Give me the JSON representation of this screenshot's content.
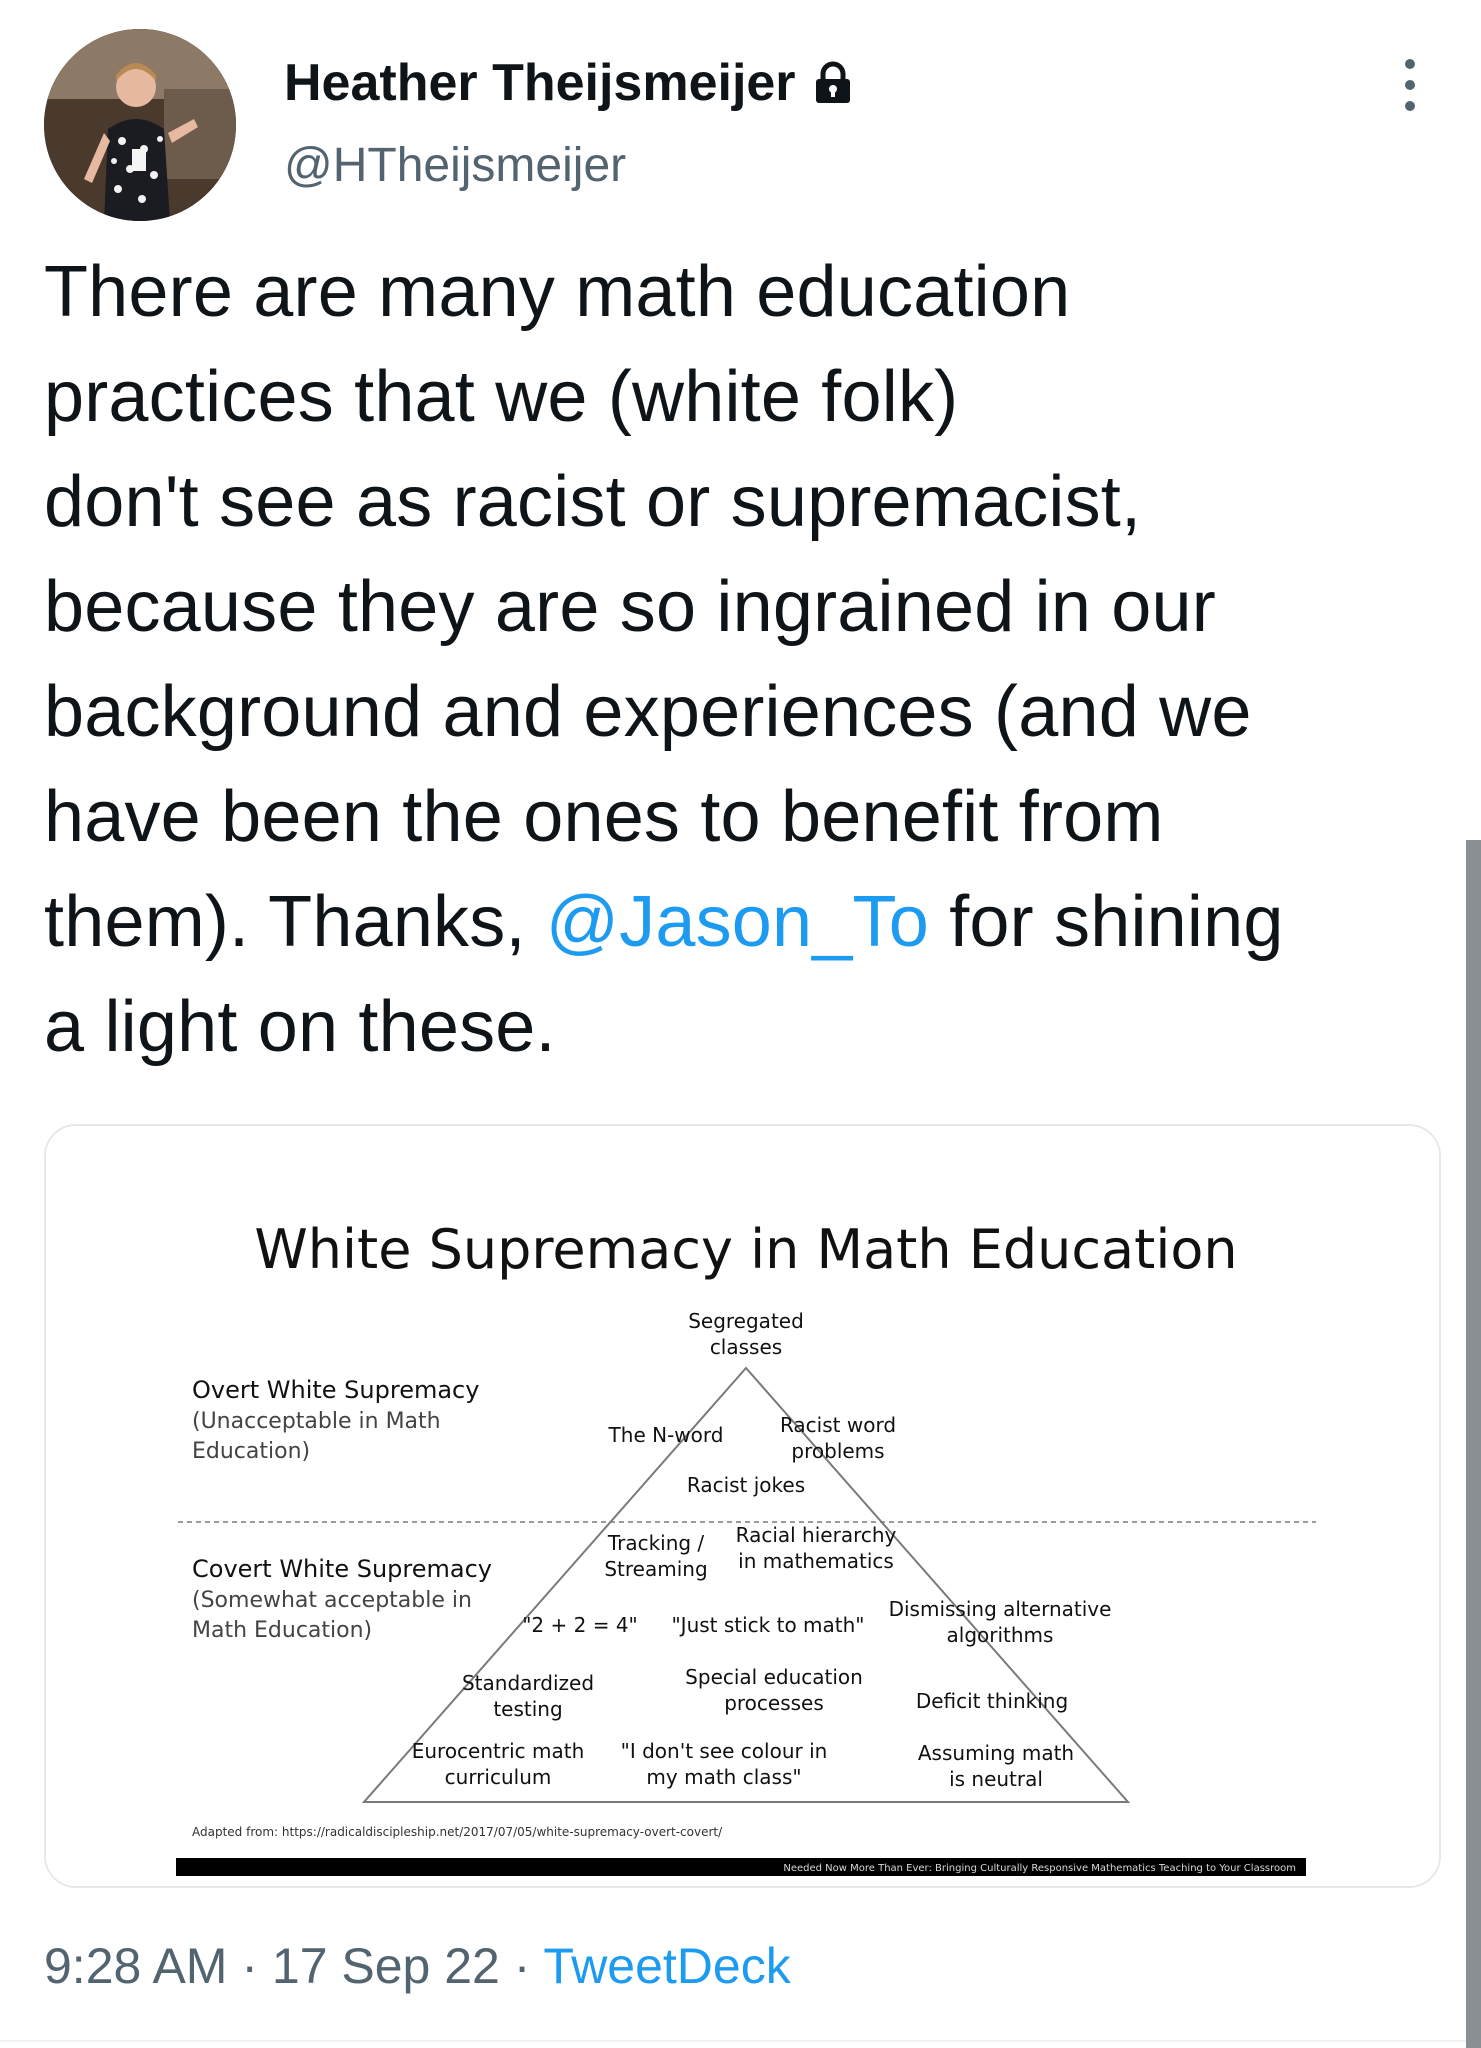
{
  "author": {
    "display_name": "Heather Theijsmeijer",
    "handle": "@HTheijsmeijer",
    "protected_icon": "lock-icon",
    "avatar": "avatar-photo"
  },
  "menu_icon": "more-vertical-icon",
  "tweet": {
    "lines": [
      "There are many math education",
      "practices that we (white folk)",
      "don't see as racist or supremacist,",
      "because they are so ingrained in our",
      "background and experiences (and we",
      "have been the ones to benefit from"
    ],
    "line7_prefix": "them). Thanks, ",
    "mention": "@Jason_To",
    "line7_suffix": " for shining",
    "line8": "a light on these."
  },
  "image": {
    "title": "White Supremacy in Math Education",
    "overt_heading": "Overt White Supremacy",
    "overt_sub_1": "(Unacceptable in Math",
    "overt_sub_2": "Education)",
    "covert_heading": "Covert White Supremacy",
    "covert_sub_1": "(Somewhat acceptable in",
    "covert_sub_2": "Math Education)",
    "apex_1": "Segregated",
    "apex_2": "classes",
    "nword": "The N-word",
    "racist_word_1": "Racist word",
    "racist_word_2": "problems",
    "racist_jokes": "Racist jokes",
    "tracking_1": "Tracking /",
    "tracking_2": "Streaming",
    "hierarchy_1": "Racial hierarchy",
    "hierarchy_2": "in mathematics",
    "dismissing_1": "Dismissing alternative",
    "dismissing_2": "algorithms",
    "two_plus_two": "\"2 + 2 = 4\"",
    "stick_to_math": "\"Just stick to math\"",
    "standardized_1": "Standardized",
    "standardized_2": "testing",
    "special_ed_1": "Special education",
    "special_ed_2": "processes",
    "deficit": "Deficit thinking",
    "eurocentric_1": "Eurocentric math",
    "eurocentric_2": "curriculum",
    "colour_1": "\"I don't see colour in",
    "colour_2": "my math class\"",
    "neutral_1": "Assuming math",
    "neutral_2": "is neutral",
    "source": "Adapted from: https://radicaldiscipleship.net/2017/07/05/white-supremacy-overt-covert/",
    "footer_banner": "Needed Now More Than Ever: Bringing Culturally Responsive Mathematics Teaching to Your Classroom"
  },
  "meta": {
    "time": "9:28 AM",
    "separator": " · ",
    "date": "17 Sep 22",
    "source_app": "TweetDeck"
  },
  "colors": {
    "mention": "#1d9bf0",
    "secondary_text": "#536471",
    "body_text": "#0f1419"
  }
}
